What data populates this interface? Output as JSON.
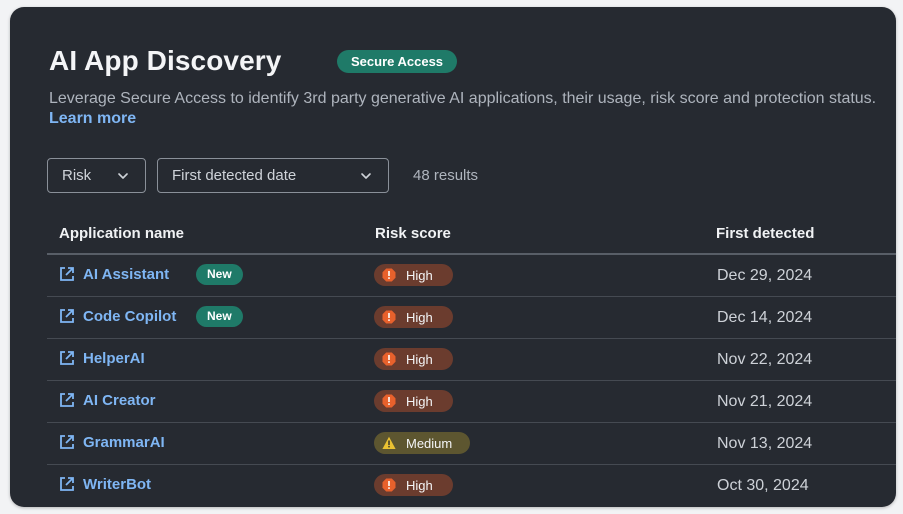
{
  "header": {
    "title": "AI App Discovery",
    "badge": "Secure Access",
    "description": "Leverage Secure Access to identify 3rd party generative AI applications, their usage, risk score and protection status.",
    "learn_more": "Learn more"
  },
  "filters": {
    "risk_label": "Risk",
    "date_label": "First detected date",
    "results": "48 results"
  },
  "table": {
    "columns": [
      "Application name",
      "Risk score",
      "First detected"
    ],
    "rows": [
      {
        "name": "AI Assistant",
        "badge": "New",
        "risk": "High",
        "date": "Dec 29, 2024"
      },
      {
        "name": "Code Copilot",
        "badge": "New",
        "risk": "High",
        "date": "Dec 14, 2024"
      },
      {
        "name": "HelperAI",
        "badge": "",
        "risk": "High",
        "date": "Nov 22, 2024"
      },
      {
        "name": "AI Creator",
        "badge": "",
        "risk": "High",
        "date": "Nov 21, 2024"
      },
      {
        "name": "GrammarAI",
        "badge": "",
        "risk": "Medium",
        "date": "Nov 13, 2024"
      },
      {
        "name": "WriterBot",
        "badge": "",
        "risk": "High",
        "date": "Oct 30, 2024"
      }
    ]
  },
  "colors": {
    "card_bg": "#262a31",
    "accent_teal": "#1f7a68",
    "link_blue": "#7fb6f4",
    "risk_high_bg": "#6b3c2e",
    "risk_high_icon": "#e8612c",
    "risk_medium_bg": "#5d5630",
    "risk_medium_icon": "#e9c132"
  },
  "icons": {
    "filter_chevron": "chevron-down-icon",
    "app_link": "external-link-icon",
    "risk_high": "alert-octagon-icon",
    "risk_medium": "warning-triangle-icon"
  }
}
